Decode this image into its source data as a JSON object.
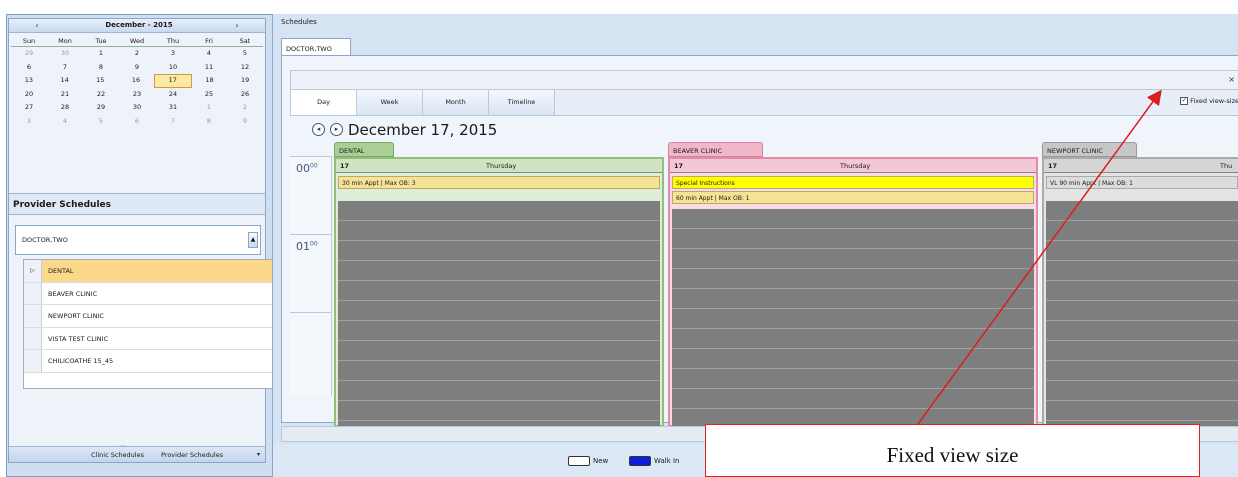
{
  "calendar": {
    "prev": "‹",
    "next": "›",
    "title": "December - 2015",
    "dow": [
      "Sun",
      "Mon",
      "Tue",
      "Wed",
      "Thu",
      "Fri",
      "Sat"
    ],
    "weeks": [
      [
        "29",
        "30",
        "1",
        "2",
        "3",
        "4",
        "5"
      ],
      [
        "6",
        "7",
        "8",
        "9",
        "10",
        "11",
        "12"
      ],
      [
        "13",
        "14",
        "15",
        "16",
        "17",
        "18",
        "19"
      ],
      [
        "20",
        "21",
        "22",
        "23",
        "24",
        "25",
        "26"
      ],
      [
        "27",
        "28",
        "29",
        "30",
        "31",
        "1",
        "2"
      ],
      [
        "3",
        "4",
        "5",
        "6",
        "7",
        "8",
        "9"
      ]
    ],
    "selected": "17"
  },
  "provider": {
    "title": "Provider Schedules",
    "selected_value": "DOCTOR,TWO",
    "list": [
      "DENTAL",
      "BEAVER CLINIC",
      "NEWPORT CLINIC",
      "VISTA TEST CLINIC",
      "CHILICOATHE 15_45"
    ],
    "marker": "▷"
  },
  "left_bottom": {
    "grip": "....",
    "clinic_label": "Clinic Schedules",
    "provider_label": "Provider Schedules",
    "chevron": "▾"
  },
  "right": {
    "title": "Schedules",
    "doc_tab": "DOCTOR,TWO",
    "close": "×",
    "tabs": [
      "Day",
      "Week",
      "Month",
      "Timeline"
    ],
    "fixed_view_label": "Fixed view-size",
    "fixed_view_checked": "✓",
    "date_prev": "◂",
    "date_next": "▸",
    "date_label": "December 17, 2015",
    "times": [
      {
        "hour": "00",
        "min": "00"
      },
      {
        "hour": "01",
        "min": "00"
      }
    ]
  },
  "resources": {
    "dental": {
      "name": "DENTAL",
      "day": "17",
      "weekday": "Thursday",
      "banners": [
        "30 min Appt | Max OB: 3"
      ]
    },
    "beaver": {
      "name": "BEAVER CLINIC",
      "day": "17",
      "weekday": "Thursday",
      "banners": [
        "Special Instructions",
        "60 min Appt | Max OB: 1"
      ]
    },
    "newport": {
      "name": "NEWPORT CLINIC",
      "day": "17",
      "weekday": "Thu",
      "banners": [
        "VL 90 min Appt | Max OB: 1"
      ]
    }
  },
  "scroll": {
    "left": "◂",
    "right": "▸",
    "thumb_grip": "⋮"
  },
  "legend": [
    {
      "label": "New",
      "color": "#ffffff"
    },
    {
      "label": "Walk In",
      "color": "#0a1fd6"
    }
  ],
  "callout": {
    "text": "Fixed view size",
    "color": "#d91f1f"
  }
}
